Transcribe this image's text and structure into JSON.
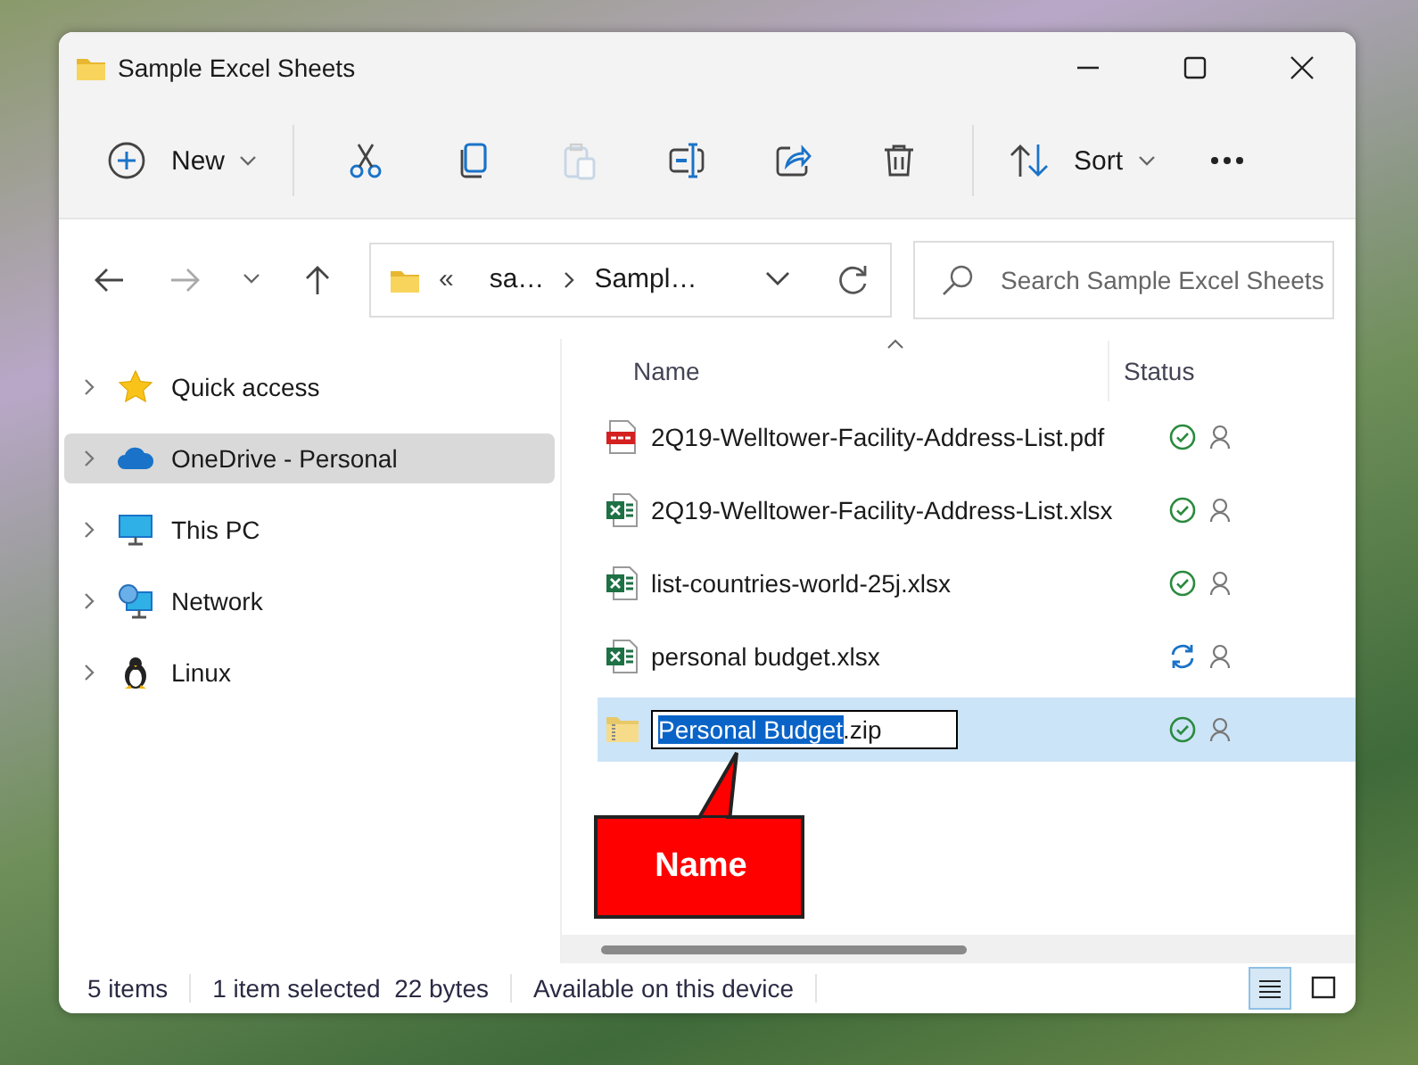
{
  "window": {
    "title": "Sample Excel Sheets"
  },
  "toolbar": [
    {
      "kind": "new",
      "label": "New",
      "disabled": false
    },
    {
      "kind": "divider"
    },
    {
      "kind": "cut",
      "disabled": false
    },
    {
      "kind": "copy",
      "disabled": false
    },
    {
      "kind": "paste",
      "disabled": true
    },
    {
      "kind": "rename",
      "disabled": false
    },
    {
      "kind": "share",
      "disabled": false
    },
    {
      "kind": "delete",
      "disabled": false
    },
    {
      "kind": "divider"
    },
    {
      "kind": "sort",
      "label": "Sort",
      "disabled": false
    },
    {
      "kind": "more",
      "disabled": false
    }
  ],
  "address": {
    "overflow": "«",
    "crumbs": [
      "sa…",
      "Sampl…"
    ]
  },
  "search": {
    "placeholder": "Search Sample Excel Sheets"
  },
  "sidebar": {
    "items": [
      {
        "label": "Quick access",
        "kind": "star",
        "selected": false
      },
      {
        "label": "OneDrive - Personal",
        "kind": "cloud",
        "selected": true
      },
      {
        "label": "This PC",
        "kind": "pc",
        "selected": false
      },
      {
        "label": "Network",
        "kind": "network",
        "selected": false
      },
      {
        "label": "Linux",
        "kind": "penguin",
        "selected": false
      }
    ]
  },
  "table": {
    "columns": [
      "Name",
      "Status"
    ],
    "rows": [
      {
        "name": "2Q19-Welltower-Facility-Address-List.pdf",
        "kind": "pdf",
        "syncing": false,
        "selected": false
      },
      {
        "name": "2Q19-Welltower-Facility-Address-List.xlsx",
        "kind": "xlsx",
        "syncing": false,
        "selected": false
      },
      {
        "name": "list-countries-world-25j.xlsx",
        "kind": "xlsx",
        "syncing": false,
        "selected": false
      },
      {
        "name": "personal budget.xlsx",
        "kind": "xlsx",
        "syncing": true,
        "selected": false
      },
      {
        "kind": "zip",
        "syncing": false,
        "selected": true,
        "rename": {
          "selected_text": "Personal Budget",
          "text": ".zip"
        }
      }
    ]
  },
  "callout": {
    "text": "Name"
  },
  "status_bar": {
    "items": [
      "5 items",
      "1 item selected  22 bytes",
      "Available on this device"
    ],
    "views": [
      {
        "kind": "details",
        "selected": true
      },
      {
        "kind": "tiles",
        "selected": false
      }
    ]
  }
}
